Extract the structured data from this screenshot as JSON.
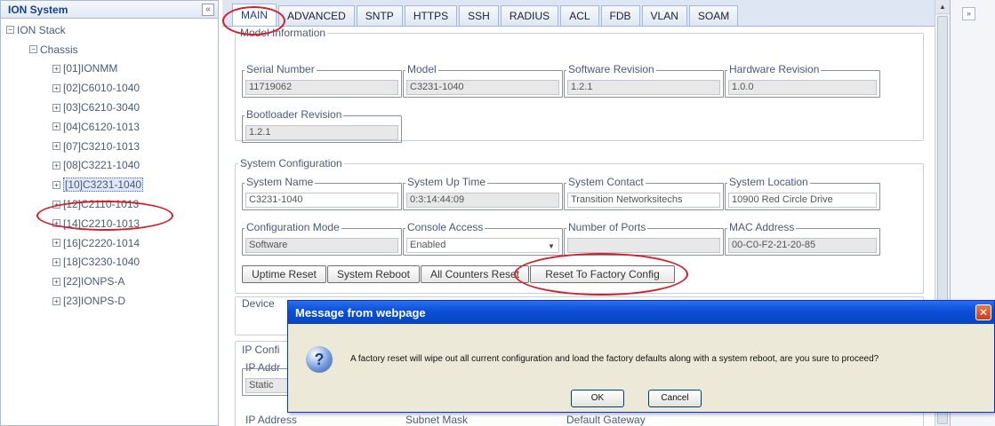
{
  "tree_panel": {
    "title": "ION System",
    "collapse_icon": "double-chevron-left-icon",
    "items": [
      {
        "label": "ION Stack",
        "expander": "−"
      },
      {
        "label": "Chassis",
        "expander": "−"
      },
      {
        "label": "[01]IONMM",
        "expander": "+"
      },
      {
        "label": "[02]C6010-1040",
        "expander": "+"
      },
      {
        "label": "[03]C6210-3040",
        "expander": "+"
      },
      {
        "label": "[04]C6120-1013",
        "expander": "+"
      },
      {
        "label": "[07]C3210-1013",
        "expander": "+"
      },
      {
        "label": "[08]C3221-1040",
        "expander": "+"
      },
      {
        "label": "[10]C3231-1040",
        "expander": "+"
      },
      {
        "label": "[12]C2110-1013",
        "expander": "+"
      },
      {
        "label": "[14]C2210-1013",
        "expander": "+"
      },
      {
        "label": "[16]C2220-1014",
        "expander": "+"
      },
      {
        "label": "[18]C3230-1040",
        "expander": "+"
      },
      {
        "label": "[22]IONPS-A",
        "expander": "+"
      },
      {
        "label": "[23]IONPS-D",
        "expander": "+"
      }
    ],
    "selected_item": "[10]C3231-1040"
  },
  "tabs": [
    "MAIN",
    "ADVANCED",
    "SNTP",
    "HTTPS",
    "SSH",
    "RADIUS",
    "ACL",
    "FDB",
    "VLAN",
    "SOAM"
  ],
  "active_tab": "MAIN",
  "model_information": {
    "legend": "Model Information",
    "serial_number": {
      "label": "Serial Number",
      "value": "11719062"
    },
    "model": {
      "label": "Model",
      "value": "C3231-1040"
    },
    "software_revision": {
      "label": "Software Revision",
      "value": "1.2.1"
    },
    "hardware_revision": {
      "label": "Hardware Revision",
      "value": "1.0.0"
    },
    "bootloader_revision": {
      "label": "Bootloader Revision",
      "value": "1.2.1"
    }
  },
  "system_configuration": {
    "legend": "System Configuration",
    "system_name": {
      "label": "System Name",
      "value": "C3231-1040"
    },
    "system_up_time": {
      "label": "System Up Time",
      "value": "0:3:14:44:09"
    },
    "system_contact": {
      "label": "System Contact",
      "value": "Transition Networksitechs"
    },
    "system_location": {
      "label": "System Location",
      "value": "10900 Red Circle Drive"
    },
    "configuration_mode": {
      "label": "Configuration Mode",
      "value": "Software"
    },
    "console_access": {
      "label": "Console Access",
      "value": "Enabled"
    },
    "number_of_ports": {
      "label": "Number of Ports",
      "value": ""
    },
    "mac_address": {
      "label": "MAC Address",
      "value": "00-C0-F2-21-20-85"
    },
    "buttons": {
      "uptime_reset": "Uptime Reset",
      "system_reboot": "System Reboot",
      "all_counters_reset": "All Counters Reset",
      "reset_factory": "Reset To Factory Config"
    }
  },
  "device_section": {
    "label": "Device"
  },
  "ip_section": {
    "legend": "IP Confi",
    "ip_addr_label": "IP Addr",
    "ip_addr_value": "Static",
    "ip_address_label": "IP Address",
    "subnet_mask_label": "Subnet Mask",
    "default_gateway_label": "Default Gateway"
  },
  "dialog": {
    "title": "Message from webpage",
    "icon": "question-icon",
    "message": "A factory reset will wipe out all current configuration and load the factory defaults along with a system reboot, are you sure to proceed?",
    "ok_label": "OK",
    "cancel_label": "Cancel",
    "close_glyph": "✕"
  },
  "colors": {
    "annotation_red": "#d31f2a",
    "tab_blue": "#15428b",
    "dialog_title_blue": "#0a4fd6"
  }
}
